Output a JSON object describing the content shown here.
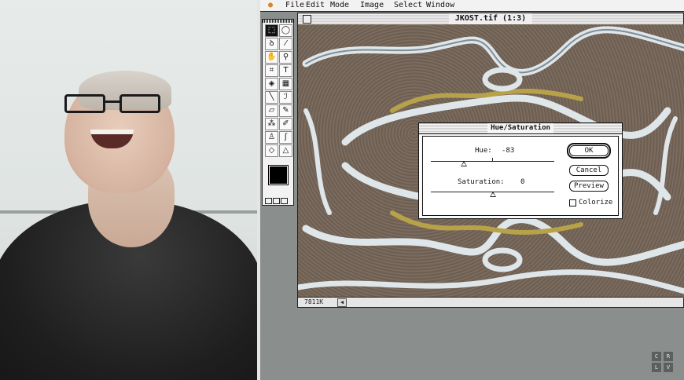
{
  "menubar": {
    "apple_icon": "apple-icon",
    "items": [
      "File",
      "Edit",
      "Mode",
      "Image",
      "Select",
      "Window"
    ]
  },
  "document": {
    "title": "JKOST.tif (1:3)",
    "memory": "7811K"
  },
  "tools": {
    "icons": [
      "marquee-icon",
      "ellipse-marquee-icon",
      "lasso-icon",
      "magic-wand-icon",
      "hand-icon",
      "zoom-icon",
      "crop-icon",
      "type-icon",
      "bucket-icon",
      "gradient-icon",
      "line-icon",
      "eyedropper-icon",
      "eraser-icon",
      "pencil-icon",
      "airbrush-icon",
      "paintbrush-icon",
      "rubber-stamp-icon",
      "smudge-icon",
      "blur-icon",
      "sharpen-icon"
    ],
    "glyphs": [
      "⬚",
      "◯",
      "ꝺ",
      "⁄",
      "✋",
      "⚲",
      "⌗",
      "T",
      "◈",
      "▦",
      "╲",
      "ℐ",
      "▱",
      "✎",
      "⁂",
      "✐",
      "♙",
      "ʃ",
      "◇",
      "△"
    ]
  },
  "dialog": {
    "title": "Hue/Saturation",
    "hue_label": "Hue:",
    "hue_value": "-83",
    "saturation_label": "Saturation:",
    "saturation_value": "0",
    "ok_label": "OK",
    "cancel_label": "Cancel",
    "preview_label": "Preview",
    "colorize_label": "Colorize",
    "hue_fraction": 0.27,
    "saturation_fraction": 0.5
  },
  "watermark": [
    "C",
    "R",
    "L",
    "V"
  ],
  "colors": {
    "accent": "#d9832b",
    "canvas": "#736456",
    "river": "#dfe6ea",
    "gold": "#b7a24a"
  }
}
